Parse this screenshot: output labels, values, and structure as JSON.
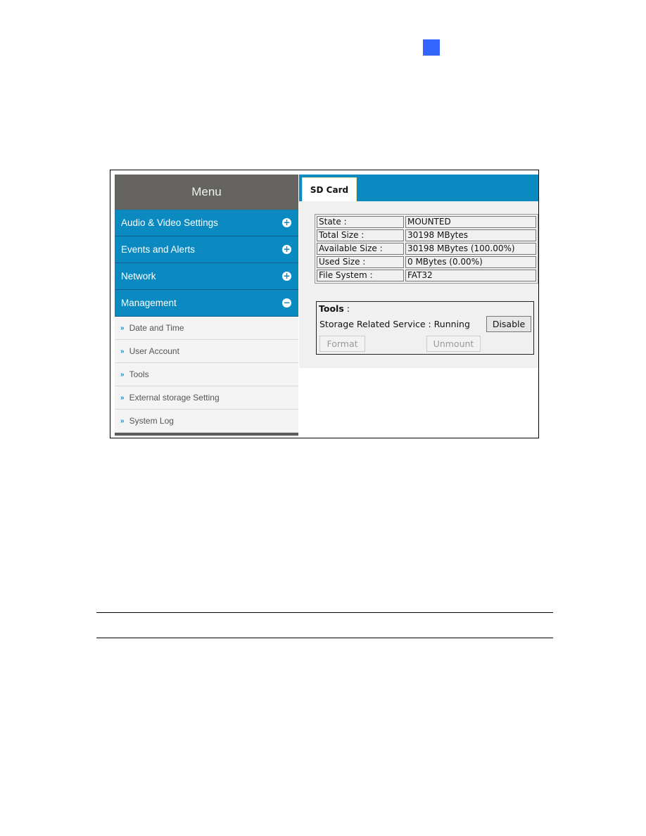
{
  "page": {
    "marker_color": "#3366ff"
  },
  "sidebar": {
    "header": "Menu",
    "sections": [
      {
        "label": "Audio & Video Settings",
        "icon": "plus-circle-icon",
        "glyph": "+"
      },
      {
        "label": "Events and Alerts",
        "icon": "plus-circle-icon",
        "glyph": "+"
      },
      {
        "label": "Network",
        "icon": "plus-circle-icon",
        "glyph": "+"
      },
      {
        "label": "Management",
        "icon": "minus-circle-icon",
        "glyph": "−"
      }
    ],
    "sub_items": [
      {
        "label": "Date and Time",
        "glyph": "»"
      },
      {
        "label": "User Account",
        "glyph": "»"
      },
      {
        "label": "Tools",
        "glyph": "»"
      },
      {
        "label": "External storage Setting",
        "glyph": "»"
      },
      {
        "label": "System Log",
        "glyph": "»"
      }
    ]
  },
  "content": {
    "tab": "SD Card",
    "info": [
      {
        "label": "State :",
        "value": "MOUNTED"
      },
      {
        "label": "Total Size :",
        "value": "30198 MBytes"
      },
      {
        "label": "Available Size :",
        "value": "30198 MBytes (100.00%)"
      },
      {
        "label": "Used Size :",
        "value": "0 MBytes (0.00%)"
      },
      {
        "label": "File System :",
        "value": "FAT32"
      }
    ],
    "tools": {
      "title": "Tools",
      "title_suffix": " :",
      "service_text": "Storage Related Service : Running",
      "disable_label": "Disable",
      "format_label": "Format",
      "unmount_label": "Unmount"
    }
  },
  "colors": {
    "menu_header": "#65635f",
    "menu_item": "#0a8ac0",
    "tab_bar": "#0a8ac0"
  }
}
